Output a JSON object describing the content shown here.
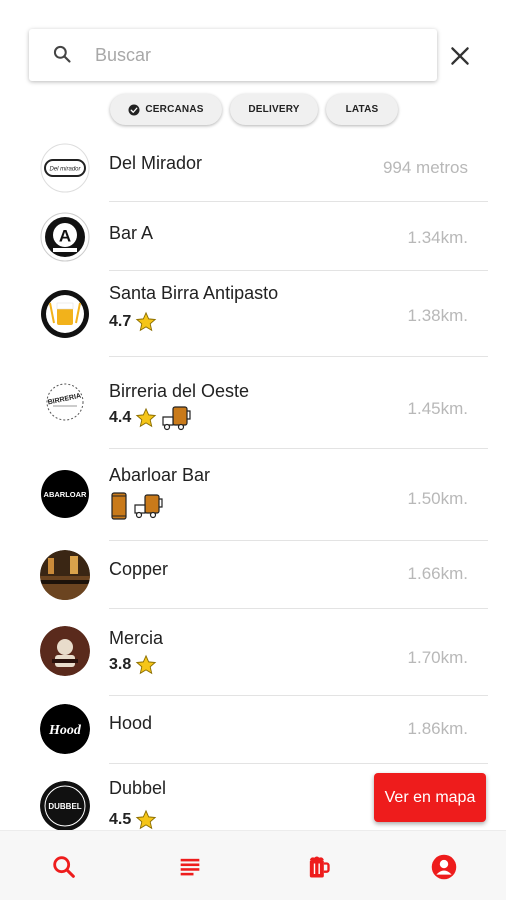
{
  "search": {
    "placeholder": "Buscar",
    "value": ""
  },
  "filters": [
    {
      "label": "CERCANAS",
      "selected": true
    },
    {
      "label": "DELIVERY",
      "selected": false
    },
    {
      "label": "LATAS",
      "selected": false
    }
  ],
  "places": [
    {
      "name": "Del Mirador",
      "distance": "994 metros"
    },
    {
      "name": "Bar A",
      "distance": "1.34km."
    },
    {
      "name": "Santa Birra Antipasto",
      "distance": "1.38km.",
      "rating": "4.7"
    },
    {
      "name": "Birreria del Oeste",
      "distance": "1.45km.",
      "rating": "4.4",
      "delivery": true
    },
    {
      "name": "Abarloar Bar",
      "distance": "1.50km.",
      "cans": true,
      "delivery": true
    },
    {
      "name": "Copper",
      "distance": "1.66km."
    },
    {
      "name": "Mercia",
      "distance": "1.70km.",
      "rating": "3.8"
    },
    {
      "name": "Hood",
      "distance": "1.86km."
    },
    {
      "name": "Dubbel",
      "distance": "",
      "rating": "4.5"
    }
  ],
  "logos": {
    "del_mirador": "Del mirador",
    "bar_a": "A",
    "birreria": "BIRRERIA",
    "abarloar": "ABARLOAR",
    "hood": "Hood",
    "dubbel": "DUBBEL"
  },
  "map_button": {
    "label": "Ver en mapa"
  },
  "bottom_nav": [
    "search-icon",
    "list-icon",
    "beer-mug-icon",
    "account-icon"
  ],
  "colors": {
    "accent": "#ee1c1c",
    "star": "#f5c518",
    "chip_bg": "#f0f0f0",
    "distance": "#b8b8b8"
  }
}
